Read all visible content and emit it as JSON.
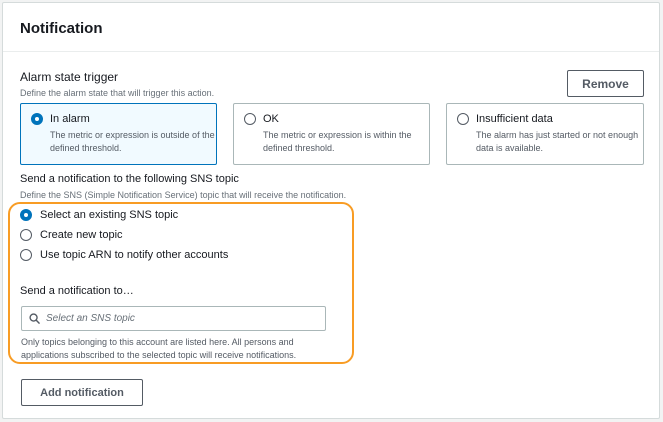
{
  "panel": {
    "title": "Notification"
  },
  "alarm_trigger": {
    "label": "Alarm state trigger",
    "description": "Define the alarm state that will trigger this action.",
    "remove_label": "Remove",
    "tiles": [
      {
        "label": "In alarm",
        "description": "The metric or expression is outside of the defined threshold.",
        "selected": true
      },
      {
        "label": "OK",
        "description": "The metric or expression is within the defined threshold.",
        "selected": false
      },
      {
        "label": "Insufficient data",
        "description": "The alarm has just started or not enough data is available.",
        "selected": false
      }
    ]
  },
  "sns": {
    "label": "Send a notification to the following SNS topic",
    "description": "Define the SNS (Simple Notification Service) topic that will receive the notification.",
    "options": [
      {
        "label": "Select an existing SNS topic",
        "selected": true
      },
      {
        "label": "Create new topic",
        "selected": false
      },
      {
        "label": "Use topic ARN to notify other accounts",
        "selected": false
      }
    ],
    "send_to_label": "Send a notification to…",
    "search_placeholder": "Select an SNS topic",
    "search_value": "",
    "help_line1": "Only topics belonging to this account are listed here. All persons and",
    "help_line2": "applications subscribed to the selected topic will receive notifications."
  },
  "add_notification_label": "Add notification",
  "colors": {
    "accent": "#0073bb",
    "highlight": "#f89c24",
    "border": "#aab7b8"
  }
}
